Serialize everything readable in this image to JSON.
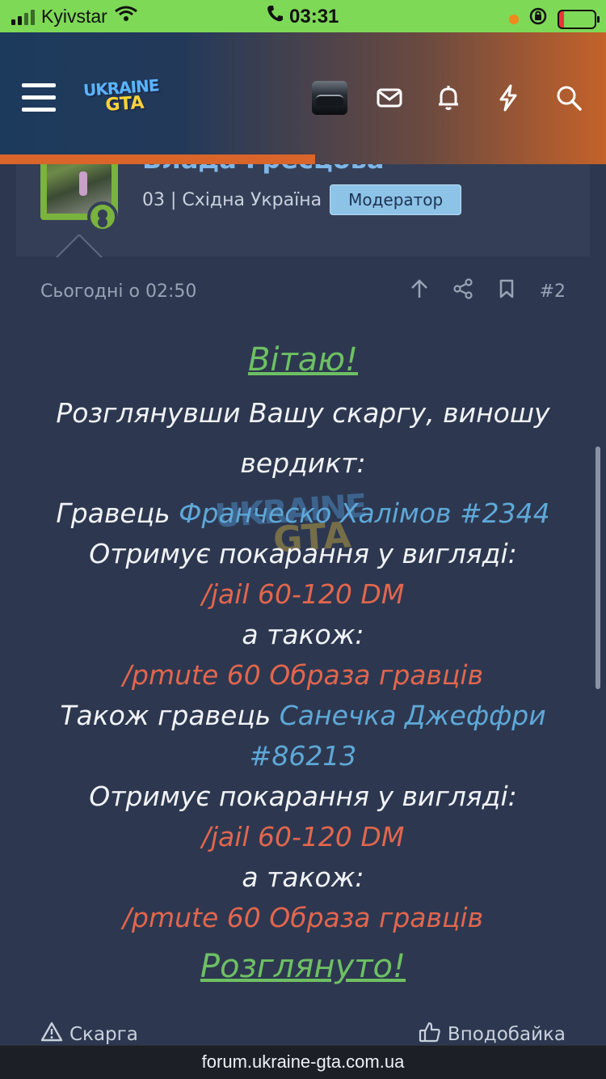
{
  "status_bar": {
    "carrier": "Kyivstar",
    "time": "03:31"
  },
  "header": {
    "logo_line1": "UKRAINE",
    "logo_line2": "GTA",
    "icons": [
      "menu-icon",
      "mail-icon",
      "bell-icon",
      "lightning-icon",
      "search-icon"
    ]
  },
  "user": {
    "name": "Влада Гресцова",
    "meta": "03 | Східна Україна",
    "badge": "Модератор"
  },
  "post": {
    "date": "Сьогодні о 02:50",
    "number": "#2",
    "lines": {
      "greeting": "Вітаю!",
      "intro": "Розглянувши Вашу скаргу, виношу вердикт:",
      "player1_prefix": "Гравець ",
      "player1_name": "Франческо Халімов #2344",
      "punish1": "Отримує покарання у вигляді:",
      "jail1": "/jail 60-120 DM",
      "also1": "а також:",
      "mute1": "/pmute 60 Образа гравців",
      "player2_prefix": "Також гравець ",
      "player2_name": "Санечка Джеффри #86213",
      "punish2": "Отримує покарання у вигляді:",
      "jail2": "/jail 60-120 DM",
      "also2": "а також:",
      "mute2": "/pmute 60 Образа гравців",
      "closing": "Розглянуто!"
    },
    "watermark_line1": "UKRAINE",
    "watermark_line2": "GTA"
  },
  "actions": {
    "report": "Скарга",
    "like": "Вподобайка"
  },
  "browser": {
    "url": "forum.ukraine-gta.com.ua"
  }
}
